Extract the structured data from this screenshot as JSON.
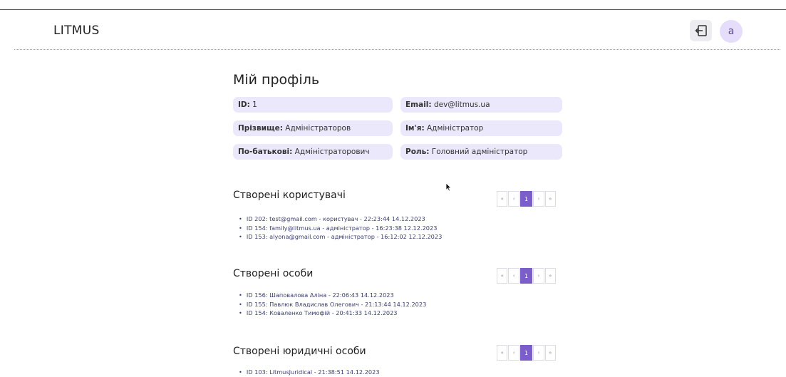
{
  "header": {
    "logo": "LITMUS",
    "avatar_letter": "a"
  },
  "icons": {
    "logout": "logout-icon",
    "cursor": "mouse-pointer-icon"
  },
  "profile": {
    "title": "Мій профіль",
    "fields": [
      {
        "label": "ID:",
        "value": "1"
      },
      {
        "label": "Email:",
        "value": "dev@litmus.ua"
      },
      {
        "label": "Прізвище:",
        "value": "Адміністраторов"
      },
      {
        "label": "Ім'я:",
        "value": "Адміністратор"
      },
      {
        "label": "По-батькові:",
        "value": "Адміністраторович"
      },
      {
        "label": "Роль:",
        "value": "Головний адміністратор"
      }
    ]
  },
  "pager": {
    "first": "«",
    "prev": "‹",
    "page": "1",
    "next": "›",
    "last": "»"
  },
  "sections": [
    {
      "title": "Створені користувачі",
      "items": [
        "ID 202: test@gmail.com - користувач - 22:23:44 14.12.2023",
        "ID 154: family@litmus.ua - адміністратор - 16:23:38 12.12.2023",
        "ID 153: alyona@gmail.com - адміністратор - 16:12:02 12.12.2023"
      ]
    },
    {
      "title": "Створені особи",
      "items": [
        "ID 156: Шаповалова Аліна - 22:06:43 14.12.2023",
        "ID 155: Павлюк Владислав Олегович - 21:13:44 14.12.2023",
        "ID 154: Коваленко Тимофій - 20:41:33 14.12.2023"
      ]
    },
    {
      "title": "Створені юридичні особи",
      "items": [
        "ID 103: LitmusJuridical - 21:38:51 14.12.2023"
      ]
    }
  ],
  "colors": {
    "accent": "#7b5ec9",
    "field_bg": "#ece8fb",
    "avatar_bg": "#e6ddfa"
  }
}
